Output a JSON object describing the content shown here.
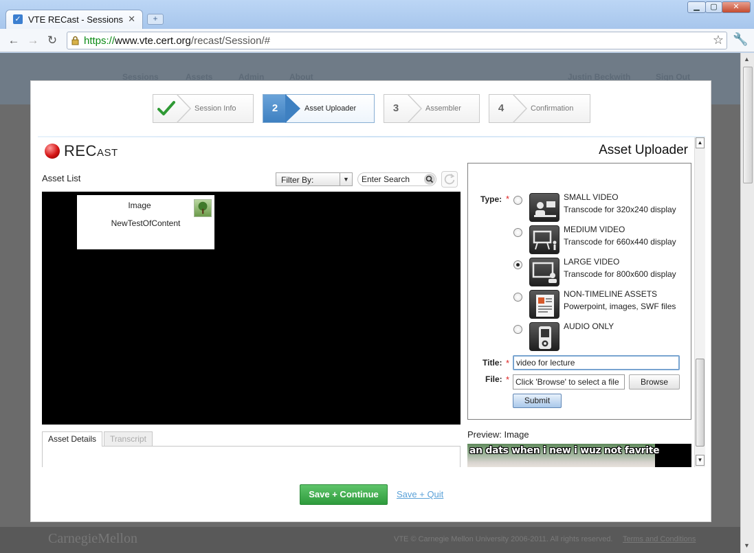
{
  "browser": {
    "tab_title": "VTE RECast - Sessions",
    "url_scheme": "https://",
    "url_host": "www.vte.cert.org",
    "url_path": "/recast/Session/#"
  },
  "background": {
    "nav": [
      "Sessions",
      "Assets",
      "Admin",
      "About"
    ],
    "user": "Justin Beckwith",
    "sign_out": "Sign Out",
    "footer_brand": "CarnegieMellon",
    "footer_copy": "VTE © Carnegie Mellon University 2006-2011. All rights reserved.",
    "footer_terms": "Terms and Conditions"
  },
  "wizard": {
    "steps": [
      {
        "num": "",
        "label": "Session Info",
        "state": "done"
      },
      {
        "num": "2",
        "label": "Asset Uploader",
        "state": "active"
      },
      {
        "num": "3",
        "label": "Assembler",
        "state": "todo"
      },
      {
        "num": "4",
        "label": "Confirmation",
        "state": "todo"
      }
    ]
  },
  "header": {
    "logo_big": "REC",
    "logo_small": "AST",
    "section_title": "Asset Uploader"
  },
  "asset_list": {
    "label": "Asset List",
    "filter_label": "Filter By:",
    "search_placeholder": "Enter Search",
    "items": [
      {
        "type": "Image",
        "name": "NewTestOfContent"
      }
    ]
  },
  "details_tabs": [
    "Asset Details",
    "Transcript"
  ],
  "uploader": {
    "type_label": "Type:",
    "title_label": "Title:",
    "file_label": "File:",
    "types": [
      {
        "name": "SMALL VIDEO",
        "desc": "Transcode for 320x240 display",
        "icon": "small-video-icon",
        "selected": false
      },
      {
        "name": "MEDIUM VIDEO",
        "desc": "Transcode for 660x440 display",
        "icon": "medium-video-icon",
        "selected": false
      },
      {
        "name": "LARGE VIDEO",
        "desc": "Transcode for 800x600 display",
        "icon": "large-video-icon",
        "selected": true
      },
      {
        "name": "NON-TIMELINE ASSETS",
        "desc": "Powerpoint, images, SWF files",
        "icon": "document-icon",
        "selected": false
      },
      {
        "name": "AUDIO ONLY",
        "desc": "",
        "icon": "audio-player-icon",
        "selected": false
      }
    ],
    "title_value": "video for lecture",
    "file_placeholder": "Click 'Browse' to select a file",
    "browse_label": "Browse",
    "submit_label": "Submit"
  },
  "preview": {
    "label": "Preview: Image",
    "caption": "an dats when i new i wuz not favrite"
  },
  "actions": {
    "save_continue": "Save + Continue",
    "save_quit": "Save + Quit"
  },
  "colors": {
    "accent": "#3e80c1",
    "primary_button": "#2e9b3c",
    "required": "#dd2222"
  }
}
